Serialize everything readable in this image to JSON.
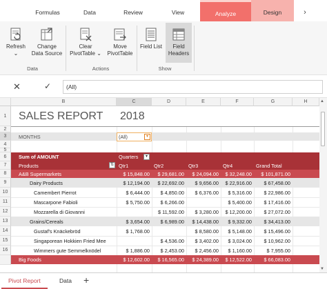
{
  "ribbon_tabs": {
    "formulas": "Formulas",
    "data": "Data",
    "review": "Review",
    "view": "View",
    "analyze": "Analyze",
    "design": "Design",
    "more": "›"
  },
  "ribbon": {
    "refresh": "Refresh",
    "refresh_caret": "⌄",
    "change_data_source_1": "Change",
    "change_data_source_2": "Data Source",
    "clear_1": "Clear",
    "clear_2": "PivotTable ⌄",
    "move_1": "Move",
    "move_2": "PivotTable",
    "field_list": "Field List",
    "field_headers_1": "Field",
    "field_headers_2": "Headers",
    "group_data": "Data",
    "group_actions": "Actions",
    "group_show": "Show"
  },
  "formula_bar": {
    "cancel": "✕",
    "confirm": "✓",
    "value": "(All)"
  },
  "columns": [
    "B",
    "C",
    "D",
    "E",
    "F",
    "G",
    "H"
  ],
  "rows": [
    "1",
    "2",
    "3",
    "4",
    "5",
    "6",
    "7",
    "8",
    "9",
    "10",
    "11",
    "12",
    "13",
    "14",
    "15",
    "16"
  ],
  "sheet": {
    "title": "SALES REPORT",
    "year": "2018",
    "months_label": "MONTHS",
    "months_value": "(All)",
    "sum_label": "Sum of AMOUNT",
    "quarters_label": "Quarters",
    "products_label": "Products",
    "q1": "Qtr1",
    "q2": "Qtr2",
    "q3": "Qtr3",
    "q4": "Qtr4",
    "grand_total": "Grand Total",
    "rows": [
      {
        "label": "A&B Supermarkets",
        "q1": "$ 15,848.00",
        "q2": "$ 29,681.00",
        "q3": "$ 24,094.00",
        "q4": "$ 32,248.00",
        "total": "$ 101,871.00"
      },
      {
        "label": "Dairy Products",
        "q1": "$ 12,194.00",
        "q2": "$ 22,692.00",
        "q3": "$ 9,656.00",
        "q4": "$ 22,916.00",
        "total": "$ 67,458.00"
      },
      {
        "label": "Camembert Pierrot",
        "q1": "$ 6,444.00",
        "q2": "$ 4,850.00",
        "q3": "$ 6,376.00",
        "q4": "$ 5,316.00",
        "total": "$ 22,986.00"
      },
      {
        "label": "Mascarpone Fabioli",
        "q1": "$ 5,750.00",
        "q2": "$ 6,266.00",
        "q3": "",
        "q4": "$ 5,400.00",
        "total": "$ 17,416.00"
      },
      {
        "label": "Mozzarella di Giovanni",
        "q1": "",
        "q2": "$ 11,592.00",
        "q3": "$ 3,280.00",
        "q4": "$ 12,200.00",
        "total": "$ 27,072.00"
      },
      {
        "label": "Grains/Cereals",
        "q1": "$ 3,654.00",
        "q2": "$ 6,989.00",
        "q3": "$ 14,438.00",
        "q4": "$ 9,332.00",
        "total": "$ 34,413.00"
      },
      {
        "label": "Gustaf's Knäckebröd",
        "q1": "$ 1,768.00",
        "q2": "",
        "q3": "$ 8,580.00",
        "q4": "$ 5,148.00",
        "total": "$ 15,496.00"
      },
      {
        "label": "Singaporean Hokkien Fried Mee",
        "q1": "",
        "q2": "$ 4,536.00",
        "q3": "$ 3,402.00",
        "q4": "$ 3,024.00",
        "total": "$ 10,962.00"
      },
      {
        "label": "Wimmers gute Semmelknödel",
        "q1": "$ 1,886.00",
        "q2": "$ 2,453.00",
        "q3": "$ 2,456.00",
        "q4": "$ 1,160.00",
        "total": "$ 7,955.00"
      },
      {
        "label": "Big Foods",
        "q1": "$ 12,602.00",
        "q2": "$ 16,565.00",
        "q3": "$ 24,389.00",
        "q4": "$ 12,522.00",
        "total": "$ 66,083.00"
      }
    ]
  },
  "sheet_tabs": {
    "pivot_report": "Pivot Report",
    "data": "Data",
    "add": "+"
  },
  "colors": {
    "accent": "#f2706b",
    "pivot_header": "#a83237",
    "pivot_total": "#c94a50"
  }
}
